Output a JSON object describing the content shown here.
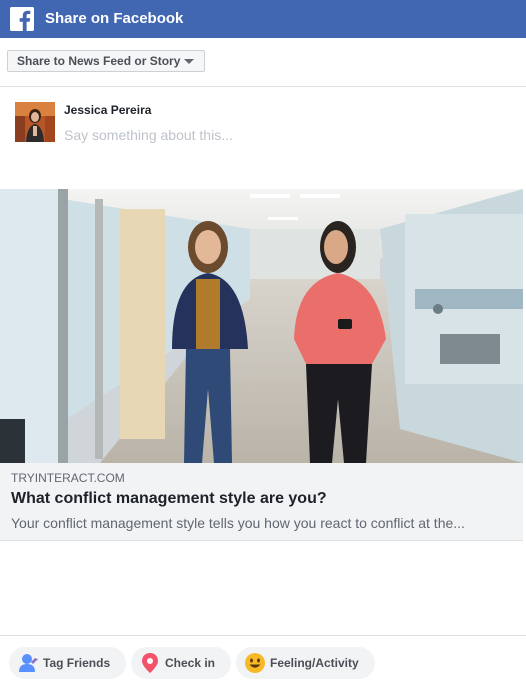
{
  "header": {
    "title": "Share on Facebook",
    "logo_icon": "facebook-logo-icon",
    "color": "#4267b2"
  },
  "audience": {
    "label": "Share to News Feed or Story",
    "icon": "caret-down-icon"
  },
  "composer": {
    "user_name": "Jessica Pereira",
    "placeholder": "Say something about this..."
  },
  "link_preview": {
    "domain": "TRYINTERACT.COM",
    "title": "What conflict management style are you?",
    "description": "Your conflict management style tells you how you react to conflict at the..."
  },
  "actions": [
    {
      "label": "Tag Friends",
      "icon": "tag-friends-icon"
    },
    {
      "label": "Check in",
      "icon": "location-pin-icon"
    },
    {
      "label": "Feeling/Activity",
      "icon": "smiley-face-icon"
    }
  ]
}
